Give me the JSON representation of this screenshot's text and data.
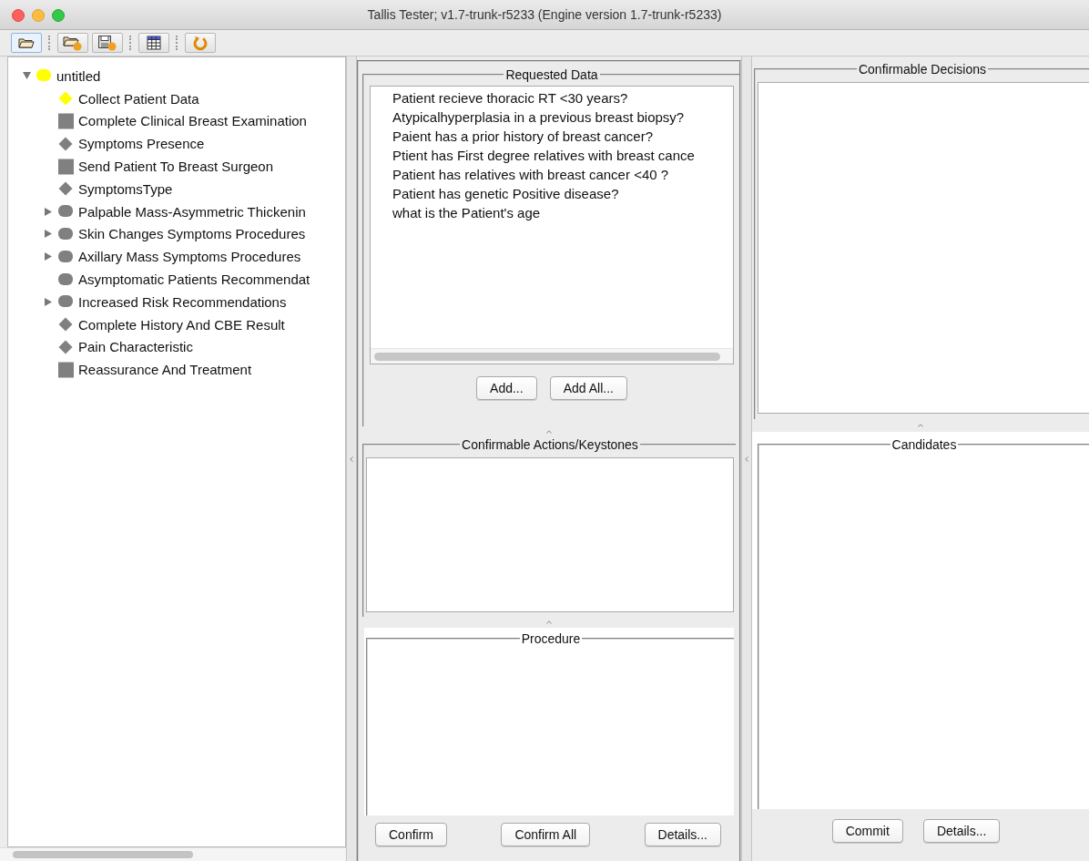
{
  "window": {
    "title": "Tallis Tester; v1.7-trunk-r5233 (Engine version 1.7-trunk-r5233)"
  },
  "toolbar": [
    {
      "kind": "open",
      "selected": true,
      "separator_before": false
    },
    {
      "kind": "open-badge",
      "selected": false,
      "separator_before": true
    },
    {
      "kind": "save-badge",
      "selected": false,
      "separator_before": false
    },
    {
      "kind": "table",
      "selected": false,
      "separator_before": true
    },
    {
      "kind": "refresh",
      "selected": false,
      "separator_before": true
    }
  ],
  "tree": {
    "label": "untitled",
    "kind": "plan",
    "color": "#ffff00",
    "expandable": true,
    "expanded": true,
    "children": [
      {
        "label": "Collect Patient Data",
        "kind": "decision",
        "color": "#ffff00",
        "expandable": false
      },
      {
        "label": "Complete Clinical Breast Examination",
        "kind": "action",
        "color": "#808080",
        "expandable": false
      },
      {
        "label": "Symptoms Presence",
        "kind": "decision",
        "color": "#808080",
        "expandable": false
      },
      {
        "label": "Send Patient To Breast Surgeon",
        "kind": "action",
        "color": "#808080",
        "expandable": false
      },
      {
        "label": "SymptomsType",
        "kind": "decision",
        "color": "#808080",
        "expandable": false
      },
      {
        "label": "Palpable Mass-Asymmetric Thickenin",
        "kind": "plan",
        "color": "#808080",
        "expandable": true,
        "expanded": false
      },
      {
        "label": "Skin Changes Symptoms Procedures",
        "kind": "plan",
        "color": "#808080",
        "expandable": true,
        "expanded": false
      },
      {
        "label": "Axillary Mass Symptoms Procedures",
        "kind": "plan",
        "color": "#808080",
        "expandable": true,
        "expanded": false
      },
      {
        "label": "Asymptomatic Patients Recommendat",
        "kind": "plan",
        "color": "#808080",
        "expandable": false
      },
      {
        "label": "Increased Risk Recommendations",
        "kind": "plan",
        "color": "#808080",
        "expandable": true,
        "expanded": false
      },
      {
        "label": "Complete History And CBE Result",
        "kind": "decision",
        "color": "#808080",
        "expandable": false
      },
      {
        "label": "Pain Characteristic",
        "kind": "decision",
        "color": "#808080",
        "expandable": false
      },
      {
        "label": "Reassurance And Treatment",
        "kind": "action",
        "color": "#808080",
        "expandable": false
      }
    ]
  },
  "requested_data": {
    "title": "Requested Data",
    "items": [
      "Patient recieve thoracic RT <30 years?",
      "Atypicalhyperplasia in a previous breast biopsy?",
      "Paient has a prior history of breast cancer?",
      "Ptient has First degree relatives with breast cance",
      "Patient has relatives with breast cancer <40 ?",
      "Patient has genetic Positive disease?",
      "what is the Patient's age"
    ],
    "buttons": [
      "Add...",
      "Add All..."
    ]
  },
  "confirmable_actions": {
    "title": "Confirmable Actions/Keystones"
  },
  "procedure": {
    "title": "Procedure",
    "buttons": [
      "Confirm",
      "Confirm All",
      "Details..."
    ]
  },
  "confirmable_decisions": {
    "title": "Confirmable Decisions"
  },
  "candidates": {
    "title": "Candidates",
    "buttons": [
      "Commit",
      "Details..."
    ]
  }
}
